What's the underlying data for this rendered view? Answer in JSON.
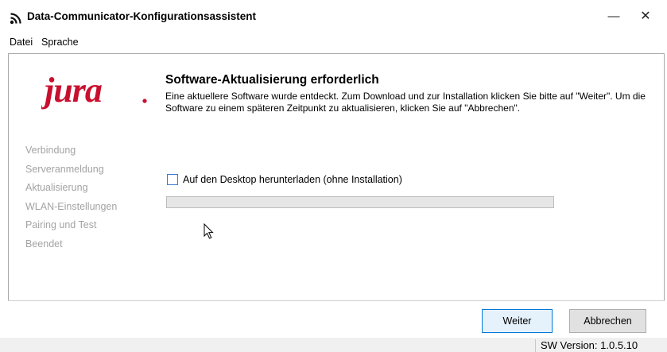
{
  "window": {
    "title": "Data-Communicator-Konfigurationsassistent",
    "minimize_symbol": "—",
    "close_symbol": "✕",
    "app_icon": "wireless-signal-icon"
  },
  "menu": {
    "items": [
      "Datei",
      "Sprache"
    ]
  },
  "brand": {
    "logo_text": "jura",
    "logo_color": "#c8102e"
  },
  "steps": {
    "items": [
      "Verbindung",
      "Serveranmeldung",
      "Aktualisierung",
      "WLAN-Einstellungen",
      "Pairing und Test",
      "Beendet"
    ],
    "color": "#a3a3a3"
  },
  "main": {
    "heading": "Software-Aktualisierung erforderlich",
    "description": "Eine aktuellere Software wurde entdeckt. Zum Download und zur Installation klicken Sie bitte auf \"Weiter\". Um die Software zu einem späteren Zeitpunkt zu aktualisieren, klicken Sie auf \"Abbrechen\".",
    "checkbox_label": "Auf den Desktop herunterladen (ohne Installation)",
    "checkbox_checked": false,
    "progress": 0
  },
  "buttons": {
    "next": "Weiter",
    "cancel": "Abbrechen"
  },
  "status": {
    "sw_version": "SW Version:  1.0.5.10"
  }
}
